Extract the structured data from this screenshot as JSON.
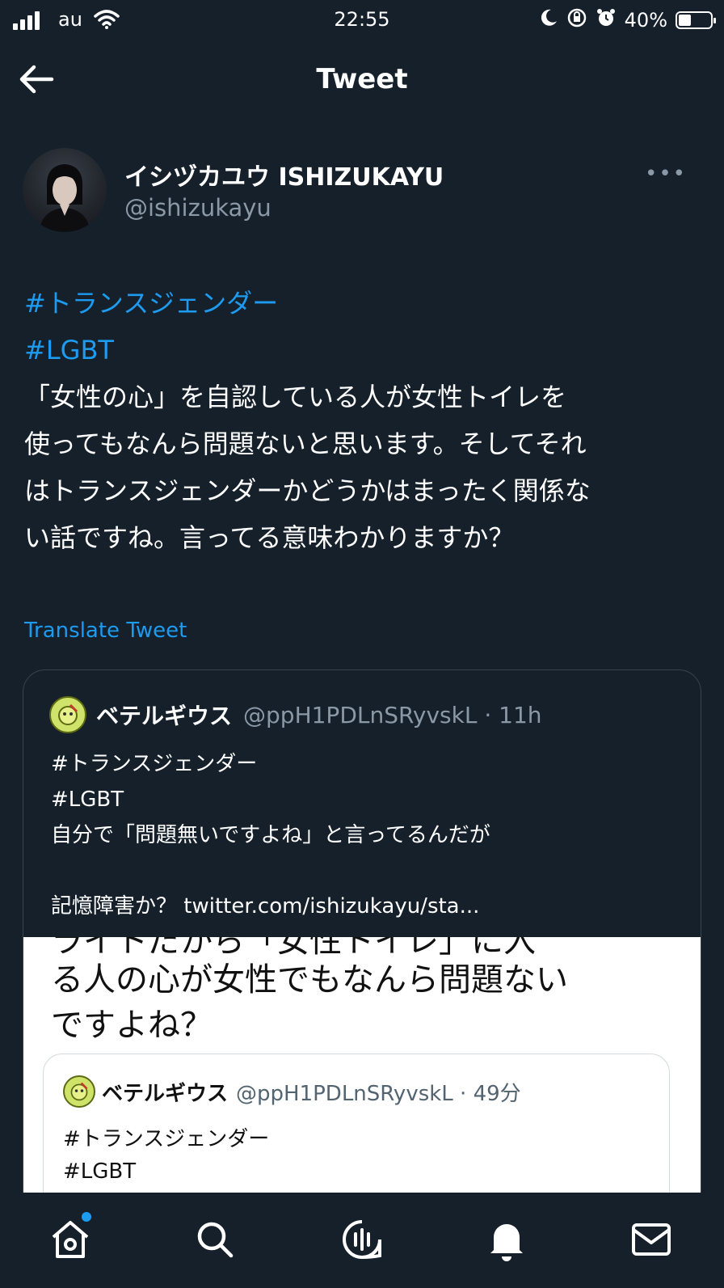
{
  "status_bar": {
    "carrier": "au",
    "time": "22:55",
    "battery_percent": "40%",
    "battery_level": 0.4,
    "icons": [
      "signal-icon",
      "wifi-icon",
      "moon-icon",
      "orientation-lock-icon",
      "alarm-icon",
      "battery-icon"
    ]
  },
  "header": {
    "title": "Tweet",
    "back_icon": "arrow-left-icon"
  },
  "tweet": {
    "author_name": "イシヅカユウ ISHIZUKAYU",
    "author_handle": "@ishizukayu",
    "more_label": "•••",
    "hashtags": [
      "#トランスジェンダー",
      "#LGBT"
    ],
    "text": "「女性の心」を自認している人が女性トイレを\n使ってもなんら問題ないと思います。そしてそれ\nはトランスジェンダーかどうかはまったく関係な\nい話ですね。言ってる意味わかりますか？",
    "translate_label": "Translate Tweet"
  },
  "quoted": {
    "name": "ベテルギウス",
    "handle_time": "@ppH1PDLnSRyvskL · 11h",
    "lines": [
      "#トランスジェンダー",
      "#LGBT",
      "自分で「問題無いですよね」と言ってるんだが"
    ],
    "last_line_prefix": "記憶障害か？ ",
    "link": "twitter.com/ishizukayu/sta...",
    "screenshot": {
      "line0": "ライトだから「女性トイレ」に入",
      "line1": "る人の心が女性でもなんら問題ない",
      "line2": "ですよね？",
      "inner_name": "ベテルギウス",
      "inner_handle_time": "@ppH1PDLnSRyvskL · 49分",
      "inner_line1": "#トランスジェンダー",
      "inner_line2": "#LGBT"
    }
  },
  "tabbar": {
    "tabs": [
      "home-icon",
      "search-icon",
      "spaces-icon",
      "notifications-icon",
      "messages-icon"
    ],
    "accent": "#1d9bf0"
  },
  "colors": {
    "background": "#15202b",
    "accent": "#1d9bf0",
    "secondary_text": "#8b98a5",
    "border": "#38444d"
  }
}
